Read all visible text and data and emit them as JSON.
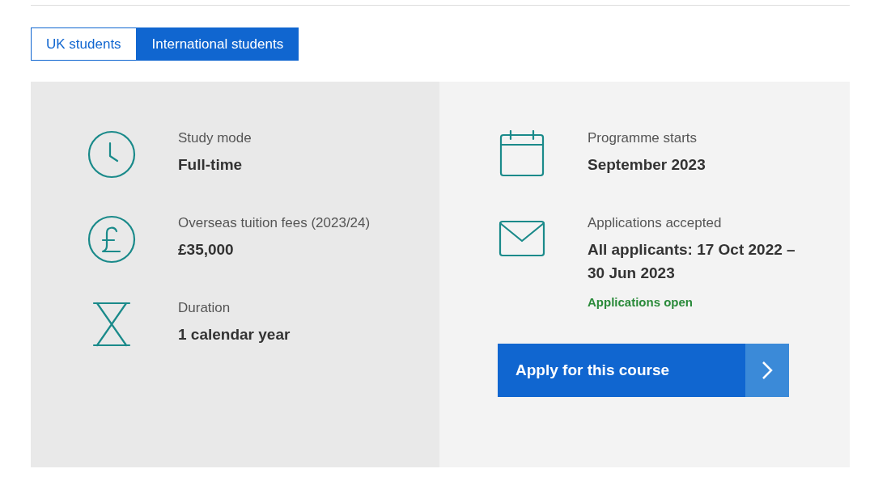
{
  "tabs": [
    {
      "label": "UK students",
      "selected": false
    },
    {
      "label": "International students",
      "selected": true
    }
  ],
  "left_items": [
    {
      "kind": "clock",
      "label": "Study mode",
      "value": "Full-time"
    },
    {
      "kind": "pound",
      "label": "Overseas tuition fees (2023/24)",
      "value": "£35,000"
    },
    {
      "kind": "hourglass",
      "label": "Duration",
      "value": "1 calendar year"
    }
  ],
  "right_items": [
    {
      "kind": "calendar",
      "label": "Programme starts",
      "value": "September 2023"
    },
    {
      "kind": "envelope",
      "label": "Applications accepted",
      "value": "All applicants: 17 Oct 2022 – 30 Jun 2023",
      "status": "Applications open"
    }
  ],
  "apply_button": {
    "label": "Apply for this course"
  }
}
